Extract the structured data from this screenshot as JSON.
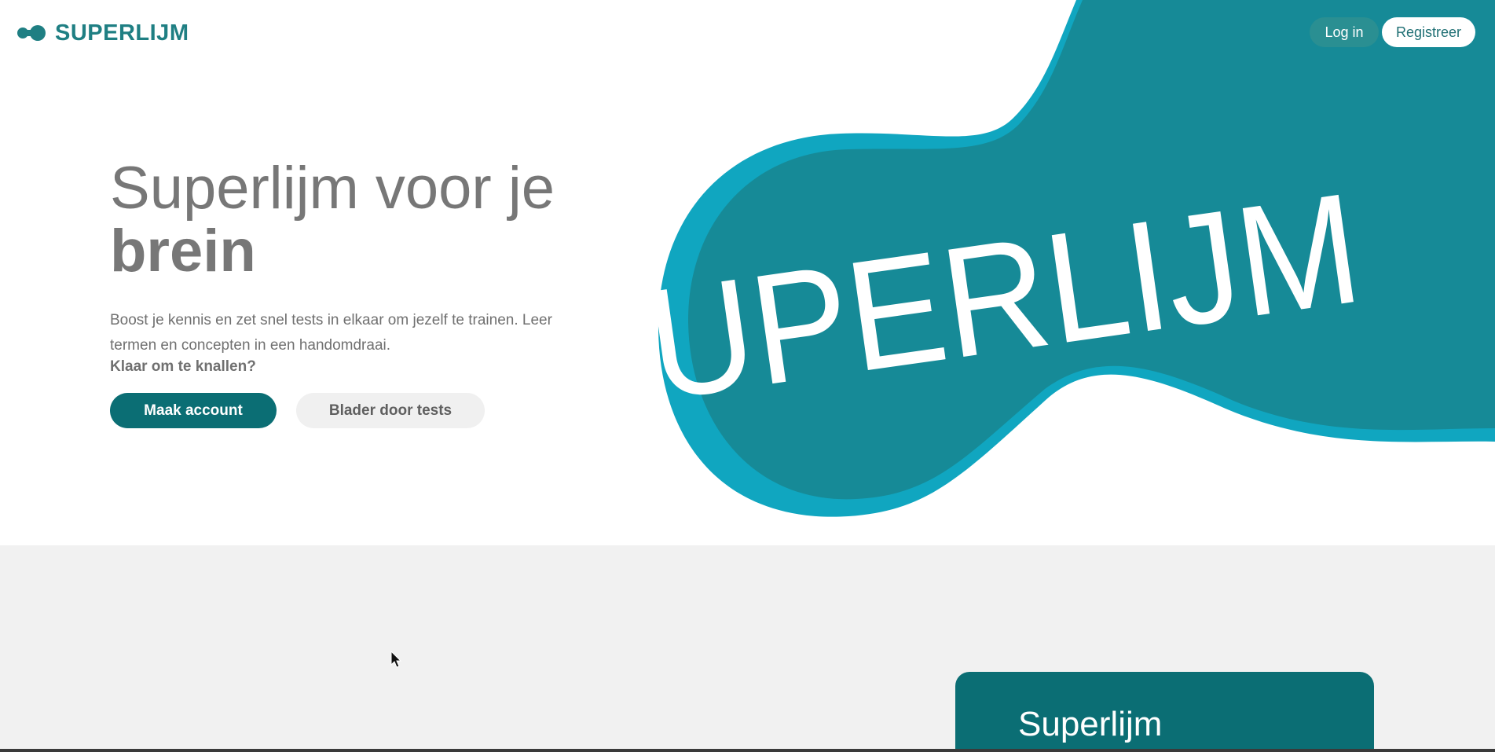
{
  "header": {
    "logo_text": "SUPERLIJM",
    "login_label": "Log in",
    "register_label": "Registreer"
  },
  "hero": {
    "title_line1": "Superlijm voor je",
    "title_line2": "brein",
    "lead": "Boost je kennis en zet snel tests in elkaar om jezelf te trainen. Leer termen en concepten in een handomdraai.",
    "cta_question": "Klaar om te knallen?",
    "primary_cta": "Maak account",
    "secondary_cta": "Blader door tests",
    "graphic_word": "SUPERLIJM"
  },
  "feature_card": {
    "title": "Superlijm"
  },
  "colors": {
    "brand_dark": "#0b6e74",
    "brand_mid": "#178a96",
    "brand_light": "#10a6c0",
    "lower_bg": "#f1f1f1"
  },
  "icons": {
    "logo": "superlijm-logo-icon",
    "cursor": "mouse-cursor-icon"
  }
}
